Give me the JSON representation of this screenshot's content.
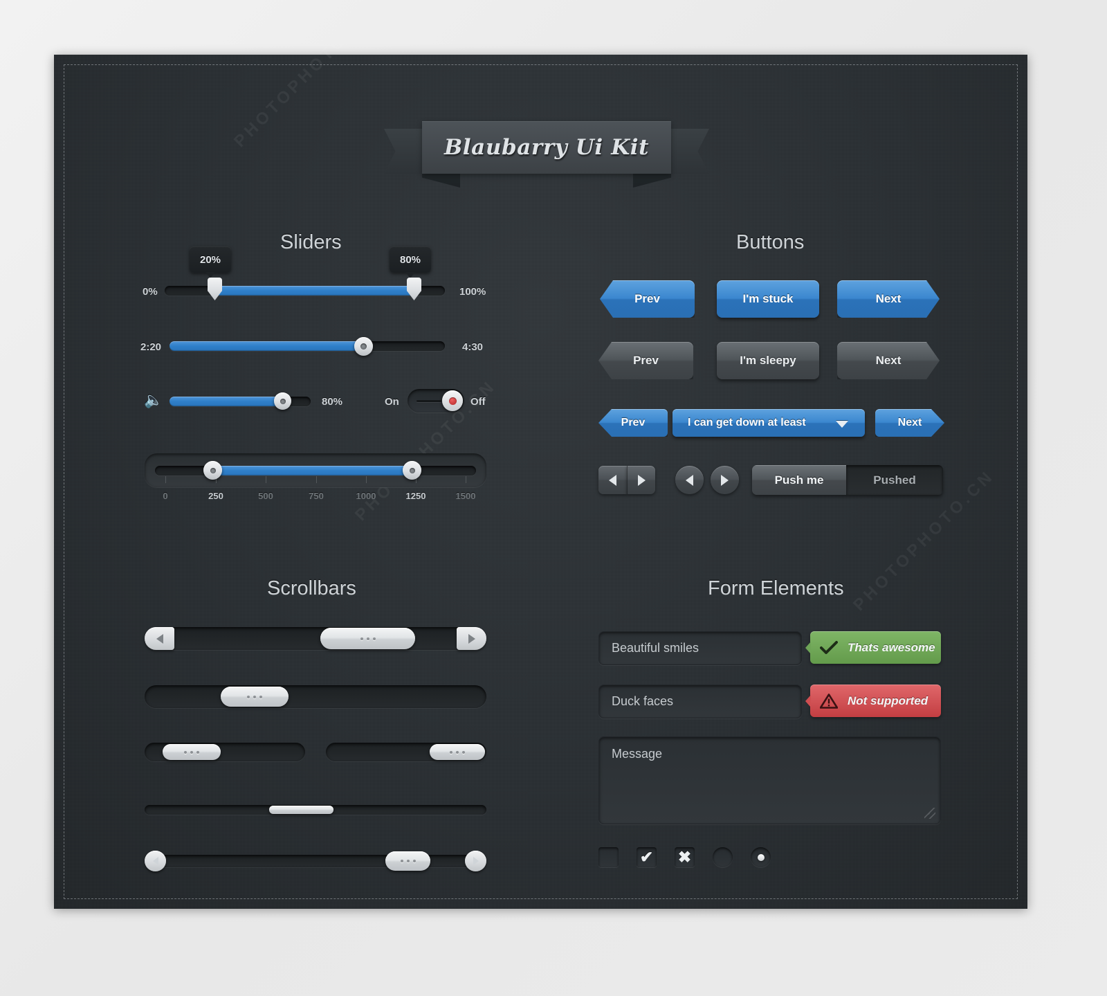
{
  "title": "Blaubarry Ui Kit",
  "sections": {
    "sliders": "Sliders",
    "buttons": "Buttons",
    "scrollbars": "Scrollbars",
    "form": "Form Elements"
  },
  "sliders": {
    "range_percent": {
      "min_label": "0%",
      "max_label": "100%",
      "low_bubble": "20%",
      "high_bubble": "80%",
      "low_value": 20,
      "high_value": 80
    },
    "time": {
      "start_label": "2:20",
      "end_label": "4:30",
      "value_percent": 62
    },
    "volume": {
      "icon": "speaker-icon",
      "value_label": "80%",
      "value_percent": 80
    },
    "toggle": {
      "on_label": "On",
      "off_label": "Off",
      "state": "Off"
    },
    "numeric_range": {
      "ticks": [
        "0",
        "250",
        "500",
        "750",
        "1000",
        "1250",
        "1500"
      ],
      "active_ticks": [
        "250",
        "1250"
      ],
      "low_value": 250,
      "high_value": 1250,
      "min": 0,
      "max": 1500
    }
  },
  "buttons": {
    "row1": [
      {
        "label": "Prev",
        "style": "blue",
        "shape": "arrow-left"
      },
      {
        "label": "I'm stuck",
        "style": "blue",
        "shape": "rounded"
      },
      {
        "label": "Next",
        "style": "blue",
        "shape": "arrow-right"
      }
    ],
    "row2": [
      {
        "label": "Prev",
        "style": "grey",
        "shape": "arrow-left"
      },
      {
        "label": "I'm sleepy",
        "style": "grey",
        "shape": "rounded"
      },
      {
        "label": "Next",
        "style": "grey",
        "shape": "arrow-right"
      }
    ],
    "row3": {
      "prev": "Prev",
      "dropdown": "I can get down at least",
      "next": "Next"
    },
    "nav": {
      "square_prev": "triangle-left-icon",
      "square_next": "triangle-right-icon",
      "circle_prev": "triangle-left-icon",
      "circle_next": "triangle-right-icon"
    },
    "segmented": {
      "unpressed": "Push me",
      "pressed": "Pushed"
    }
  },
  "form": {
    "input1": {
      "value": "Beautiful smiles",
      "badge": "Thats awesome",
      "badge_state": "success",
      "badge_icon": "check-icon"
    },
    "input2": {
      "value": "Duck faces",
      "badge": "Not supported",
      "badge_state": "error",
      "badge_icon": "warning-icon"
    },
    "textarea": {
      "placeholder": "Message"
    },
    "choices": [
      {
        "type": "checkbox",
        "name": "checkbox-empty",
        "glyph": ""
      },
      {
        "type": "checkbox",
        "name": "checkbox-checked",
        "glyph": "✔"
      },
      {
        "type": "checkbox",
        "name": "checkbox-crossed",
        "glyph": "✖"
      },
      {
        "type": "radio",
        "name": "radio-empty",
        "selected": false
      },
      {
        "type": "radio",
        "name": "radio-selected",
        "selected": true
      }
    ]
  },
  "colors": {
    "accent_blue": "#2f7fc9",
    "panel_bg": "#2e3337",
    "success_green": "#639b4b",
    "error_red": "#c33e42"
  }
}
